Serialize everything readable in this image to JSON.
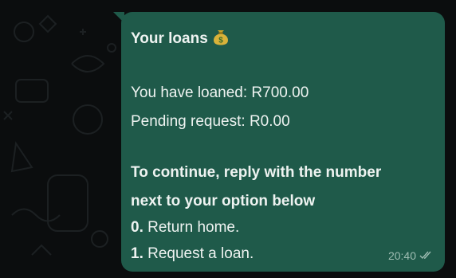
{
  "message": {
    "title": "Your loans",
    "title_emoji": "money-bag-icon",
    "loaned": "You have loaned: R700.00",
    "pending": "Pending request: R0.00",
    "instruction_line1": "To continue, reply with the number",
    "instruction_line2": "next to your option below",
    "options": [
      {
        "number": "0.",
        "label": " Return home."
      },
      {
        "number": "1.",
        "label": " Request a loan."
      }
    ],
    "time": "20:40",
    "status_icon": "double-check-icon"
  },
  "colors": {
    "background": "#0b0d0e",
    "bubble": "#1f5a4a",
    "text": "#eef3f1",
    "meta": "#9fbdb3"
  }
}
